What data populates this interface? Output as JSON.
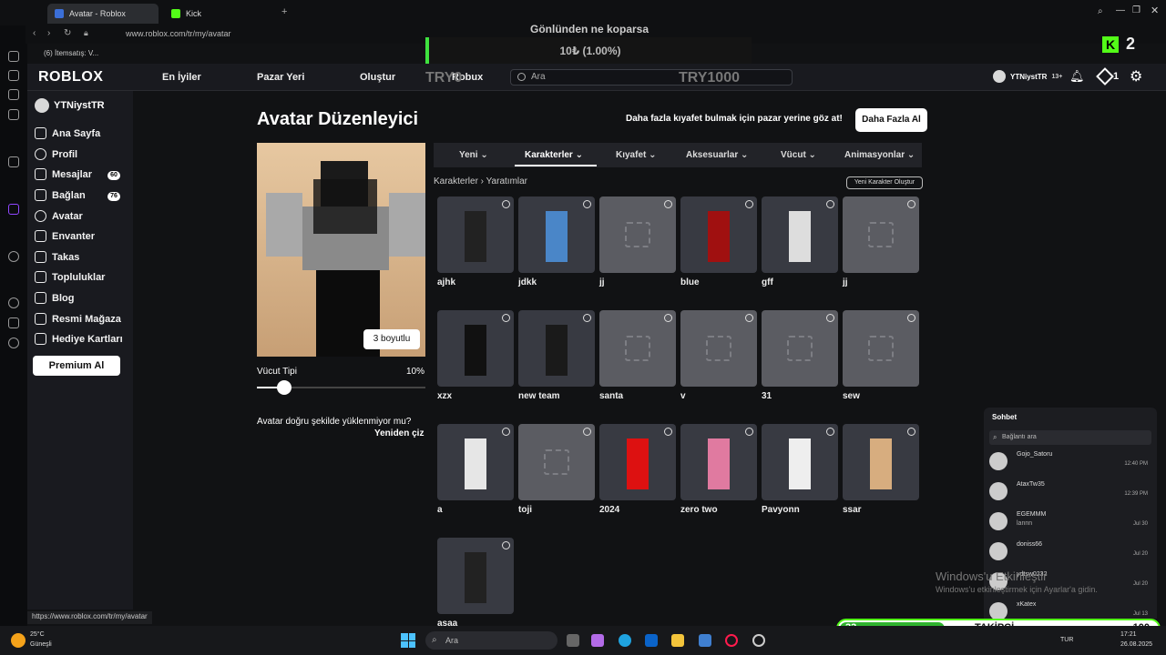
{
  "browser": {
    "tabs": [
      {
        "label": "Avatar - Roblox"
      },
      {
        "label": "Kick"
      }
    ],
    "url": "www.roblox.com/tr/my/avatar",
    "bookmark": "(6) İtemsatış: V...",
    "status_url": "https://www.roblox.com/tr/my/avatar"
  },
  "nav": {
    "logo": "ROBLOX",
    "links": [
      "En İyiler",
      "Pazar Yeri",
      "Oluştur",
      "Robux"
    ],
    "search_placeholder": "Ara",
    "username": "YTNiystTR",
    "age": "13+",
    "robux": "1"
  },
  "sidebar": {
    "username": "YTNiystTR",
    "items": [
      {
        "label": "Ana Sayfa"
      },
      {
        "label": "Profil"
      },
      {
        "label": "Mesajlar",
        "badge": "60"
      },
      {
        "label": "Bağlan",
        "badge": "76"
      },
      {
        "label": "Avatar"
      },
      {
        "label": "Envanter"
      },
      {
        "label": "Takas"
      },
      {
        "label": "Topluluklar"
      },
      {
        "label": "Blog"
      },
      {
        "label": "Resmi Mağaza"
      },
      {
        "label": "Hediye Kartları"
      }
    ],
    "premium": "Premium Al"
  },
  "editor": {
    "title": "Avatar Düzenleyici",
    "promo": "Daha fazla kıyafet bulmak için pazar yerine göz at!",
    "more_button": "Daha Fazla Al",
    "btn3d": "3 boyutlu",
    "body_type_label": "Vücut Tipi",
    "body_type_value": "10%",
    "body_type_fraction": 0.1,
    "load_msg": "Avatar doğru şekilde yüklenmiyor mu?",
    "redraw": "Yeniden çiz",
    "tabs": [
      "Yeni",
      "Karakterler",
      "Kıyafet",
      "Aksesuarlar",
      "Vücut",
      "Animasyonlar"
    ],
    "breadcrumb": {
      "root": "Karakterler",
      "current": "Yaratımlar"
    },
    "new_character": "Yeni Karakter Oluştur",
    "characters": [
      {
        "name": "ajhk",
        "empty": false,
        "color": "#222"
      },
      {
        "name": "jdkk",
        "empty": false,
        "color": "#4a86c8"
      },
      {
        "name": "jj",
        "empty": true
      },
      {
        "name": "blue",
        "empty": false,
        "color": "#a01010"
      },
      {
        "name": "gff",
        "empty": false,
        "color": "#ddd"
      },
      {
        "name": "jj",
        "empty": true
      },
      {
        "name": "xzx",
        "empty": false,
        "color": "#111"
      },
      {
        "name": "new team",
        "empty": false,
        "color": "#1a1a1a"
      },
      {
        "name": "santa",
        "empty": true
      },
      {
        "name": "v",
        "empty": true
      },
      {
        "name": "31",
        "empty": true
      },
      {
        "name": "sew",
        "empty": true
      },
      {
        "name": "a",
        "empty": false,
        "color": "#e6e6e6"
      },
      {
        "name": "toji",
        "empty": true
      },
      {
        "name": "2024",
        "empty": false,
        "color": "#d11"
      },
      {
        "name": "zero two",
        "empty": false,
        "color": "#e07aa0"
      },
      {
        "name": "Pavyonn",
        "empty": false,
        "color": "#eee"
      },
      {
        "name": "ssar",
        "empty": false,
        "color": "#d7ad7f"
      },
      {
        "name": "asaa",
        "empty": false,
        "color": "#222"
      }
    ]
  },
  "chat": {
    "title": "Sohbet",
    "search_placeholder": "Bağlantı ara",
    "items": [
      {
        "name": "Gojo_Satoru",
        "msg": "",
        "time": "12:40 PM"
      },
      {
        "name": "AtaxTw35",
        "msg": "",
        "time": "12:39 PM"
      },
      {
        "name": "EGEMMM",
        "msg": "lannn",
        "time": "Jul 30"
      },
      {
        "name": "doniss66",
        "msg": "",
        "time": "Jul 20"
      },
      {
        "name": "ydtsw0232",
        "msg": "",
        "time": "Jul 20"
      },
      {
        "name": "xKatex",
        "msg": "",
        "time": "Jul 13"
      }
    ]
  },
  "stream": {
    "title": "Gönlünden ne koparsa",
    "progress": "10₺ (1.00%)",
    "progress_fraction": 0.01,
    "min_label": "TRY0",
    "max_label": "TRY1000",
    "kick_count": "2",
    "follow_current": "33",
    "follow_label": "TAKİPÇİ",
    "follow_goal": "100",
    "follow_fraction": 0.33
  },
  "windows": {
    "watermark_title": "Windows'u Etkinleştir",
    "watermark_sub": "Windows'u etkinleştirmek için Ayarlar'a gidin.",
    "weather_temp": "25°C",
    "weather_desc": "Güneşli",
    "search": "Ara",
    "lang": "TUR",
    "time": "17:21",
    "date": "26.08.2025"
  },
  "colors": {
    "accent_green": "#53fc18",
    "bg": "#111214",
    "panel": "#191a1f"
  }
}
